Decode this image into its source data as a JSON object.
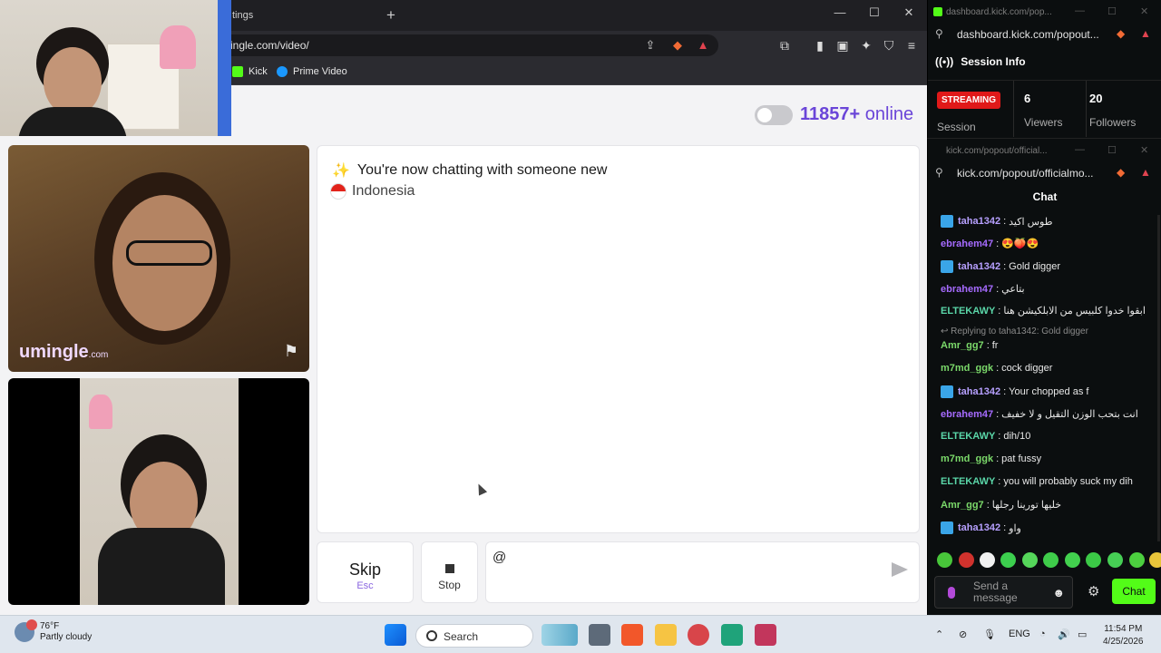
{
  "browser": {
    "tab_title": "tings",
    "url": "ingle.com/video/",
    "bookmarks": [
      {
        "label": "Kick"
      },
      {
        "label": "Prime Video"
      }
    ]
  },
  "page": {
    "online_count": "11857+",
    "online_word": "online",
    "chat_intro": "You're now chatting with someone new",
    "country": "Indonesia",
    "brand": "umingle",
    "brand_suffix": ".com",
    "skip_label": "Skip",
    "skip_hint": "Esc",
    "stop_label": "Stop",
    "message_value": "@"
  },
  "kick_session": {
    "window_title": "dashboard.kick.com/pop...",
    "url": "dashboard.kick.com/popout...",
    "heading": "Session Info",
    "status_badge": "STREAMING",
    "session_label": "Session",
    "viewers_value": "6",
    "viewers_label": "Viewers",
    "followers_value": "20",
    "followers_label": "Followers"
  },
  "kick_chat": {
    "window_title": "kick.com/popout/official...",
    "url": "kick.com/popout/officialmo...",
    "heading": "Chat",
    "messages": [
      {
        "user": "taha1342",
        "color": "#b7a0ff",
        "badge": true,
        "text": "طوس اكيد"
      },
      {
        "user": "ebrahem47",
        "color": "#a66bff",
        "badge": false,
        "text": "😍🍑😍"
      },
      {
        "user": "taha1342",
        "color": "#b7a0ff",
        "badge": true,
        "text": "Gold digger"
      },
      {
        "user": "ebrahem47",
        "color": "#a66bff",
        "badge": false,
        "text": "بتاعي"
      },
      {
        "user": "ELTEKAWY",
        "color": "#5ad6a8",
        "badge": false,
        "text": "ابقوا خدوا كلبيس من الابلكيشن هنا"
      },
      {
        "reply": "Replying to taha1342: Gold digger"
      },
      {
        "user": "Amr_gg7",
        "color": "#7bd96a",
        "badge": false,
        "text": "fr"
      },
      {
        "user": "m7md_ggk",
        "color": "#7bd96a",
        "badge": false,
        "text": "cock digger"
      },
      {
        "user": "taha1342",
        "color": "#b7a0ff",
        "badge": true,
        "text": "Your chopped as f"
      },
      {
        "user": "ebrahem47",
        "color": "#a66bff",
        "badge": false,
        "text": "انت بتحب الوزن التقيل و لا خفيف"
      },
      {
        "user": "ELTEKAWY",
        "color": "#5ad6a8",
        "badge": false,
        "text": "dih/10"
      },
      {
        "user": "m7md_ggk",
        "color": "#7bd96a",
        "badge": false,
        "text": "pat fussy"
      },
      {
        "user": "ELTEKAWY",
        "color": "#5ad6a8",
        "badge": false,
        "text": "you will probably suck my dih"
      },
      {
        "user": "Amr_gg7",
        "color": "#7bd96a",
        "badge": false,
        "text": "خليها تورينا رجلها"
      },
      {
        "user": "taha1342",
        "color": "#b7a0ff",
        "badge": true,
        "text": "واو"
      }
    ],
    "send_placeholder": "Send a message",
    "chat_button": "Chat"
  },
  "taskbar": {
    "temperature": "76°F",
    "weather": "Partly cloudy",
    "search_label": "Search",
    "language": "ENG",
    "time": "11:54 PM",
    "date": "4/25/2026"
  }
}
